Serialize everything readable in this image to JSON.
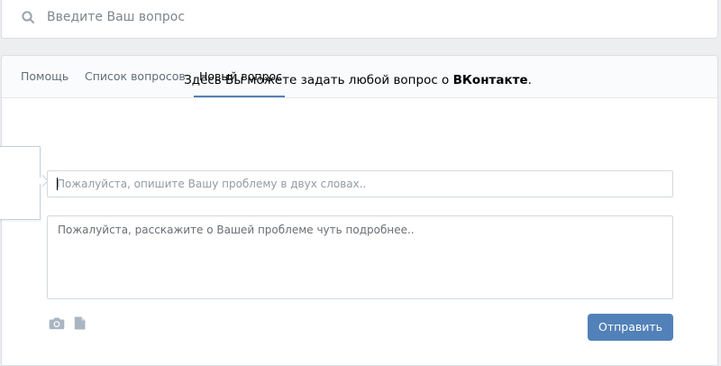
{
  "search": {
    "placeholder": "Введите Ваш вопрос",
    "icon": "search-icon"
  },
  "tabs": [
    {
      "label": "Помощь",
      "active": false
    },
    {
      "label": "Список вопросов",
      "active": false
    },
    {
      "label": "Новый вопрос",
      "active": true
    }
  ],
  "intro": {
    "prefix": "Здесь Вы можете задать любой вопрос о ",
    "brand": "ВКонтакте",
    "suffix": "."
  },
  "form": {
    "title_placeholder": "Пожалуйста, опишите Вашу проблему в двух словах..",
    "body_placeholder": "Пожалуйста, расскажите о Вашей проблеме чуть подробнее..",
    "send_label": "Отправить",
    "attach_icons": [
      "camera-icon",
      "document-icon"
    ]
  },
  "colors": {
    "accent": "#5181b8",
    "background": "#edeef0",
    "tab_inactive": "#626d7a"
  }
}
